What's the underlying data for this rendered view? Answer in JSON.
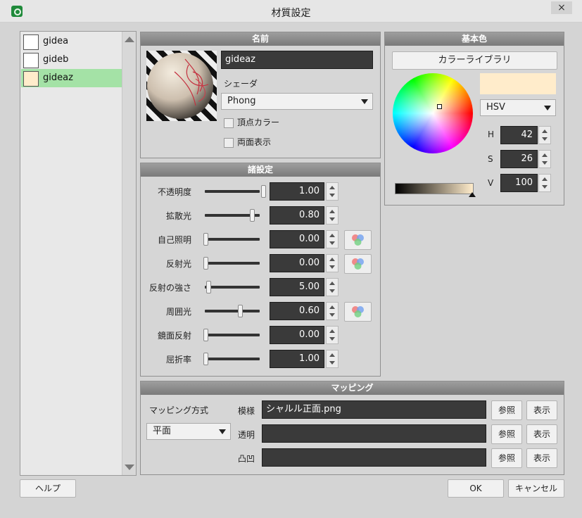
{
  "window": {
    "title": "材質設定"
  },
  "materials": [
    {
      "name": "gidea",
      "color": "#ffffff"
    },
    {
      "name": "gideb",
      "color": "#ffffff"
    },
    {
      "name": "gideaz",
      "color": "#ffeccb"
    }
  ],
  "name_panel": {
    "header": "名前",
    "name_value": "gideaz",
    "shader_label": "シェーダ",
    "shader_value": "Phong",
    "vertex_color_label": "頂点カラー",
    "double_sided_label": "両面表示"
  },
  "settings_panel": {
    "header": "諸設定",
    "rows": [
      {
        "label": "不透明度",
        "value": "1.00",
        "level": 1.0,
        "has_color_button": false
      },
      {
        "label": "拡散光",
        "value": "0.80",
        "level": 0.8,
        "has_color_button": false
      },
      {
        "label": "自己照明",
        "value": "0.00",
        "level": 0.0,
        "has_color_button": true
      },
      {
        "label": "反射光",
        "value": "0.00",
        "level": 0.0,
        "has_color_button": true
      },
      {
        "label": "反射の強さ",
        "value": "5.00",
        "level": 0.05,
        "has_color_button": false
      },
      {
        "label": "周囲光",
        "value": "0.60",
        "level": 0.6,
        "has_color_button": true
      },
      {
        "label": "鏡面反射",
        "value": "0.00",
        "level": 0.0,
        "has_color_button": false
      },
      {
        "label": "屈折率",
        "value": "1.00",
        "level": 0.0,
        "has_color_button": false
      }
    ]
  },
  "base_color_panel": {
    "header": "基本色",
    "library_button": "カラーライブラリ",
    "swatch_color": "#ffeccb",
    "mode_value": "HSV",
    "h_label": "H",
    "h_value": "42",
    "s_label": "S",
    "s_value": "26",
    "v_label": "V",
    "v_value": "100",
    "value_level": 1.0
  },
  "mapping_panel": {
    "header": "マッピング",
    "method_label": "マッピング方式",
    "method_value": "平面",
    "pattern_label": "模様",
    "pattern_value": "シャルル正面.png",
    "transparency_label": "透明",
    "transparency_value": "",
    "bump_label": "凸凹",
    "bump_value": "",
    "browse_label": "参照",
    "show_label": "表示"
  },
  "footer": {
    "help": "ヘルプ",
    "ok": "OK",
    "cancel": "キャンセル"
  },
  "icons": {
    "close": "×",
    "app": "app-icon"
  }
}
